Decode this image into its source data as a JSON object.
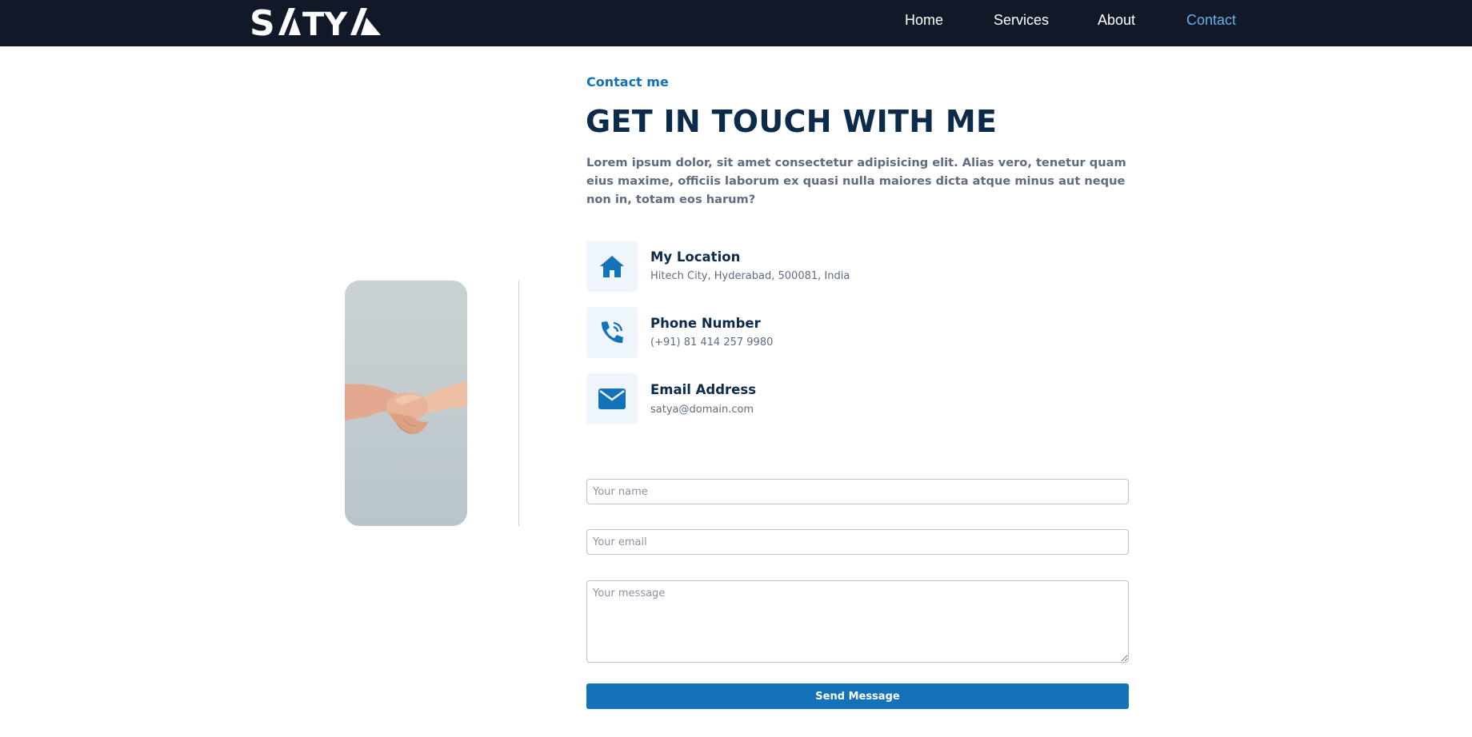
{
  "header": {
    "brand": "SATYA",
    "nav": [
      {
        "label": "Home",
        "active": false
      },
      {
        "label": "Services",
        "active": false
      },
      {
        "label": "About",
        "active": false
      },
      {
        "label": "Contact",
        "active": true
      }
    ]
  },
  "contact": {
    "eyebrow": "Contact me",
    "title": "GET IN TOUCH WITH ME",
    "intro": "Lorem ipsum dolor, sit amet consectetur adipisicing elit. Alias vero, tenetur quam eius maxime, officiis laborum ex quasi nulla maiores dicta atque minus aut neque non in, totam eos harum?",
    "items": [
      {
        "icon": "home-icon",
        "title": "My Location",
        "text": "Hitech City, Hyderabad, 500081, India"
      },
      {
        "icon": "phone-icon",
        "title": "Phone Number",
        "text": "(+91) 81 414 257 9980"
      },
      {
        "icon": "envelope-icon",
        "title": "Email Address",
        "text": "satya@domain.com"
      }
    ]
  },
  "form": {
    "name_placeholder": "Your name",
    "email_placeholder": "Your email",
    "message_placeholder": "Your message",
    "submit_label": "Send Message"
  },
  "colors": {
    "navbar": "#111827",
    "accent": "#1473b8",
    "active_nav": "#5fb3e8",
    "heading": "#0c2a4a"
  }
}
